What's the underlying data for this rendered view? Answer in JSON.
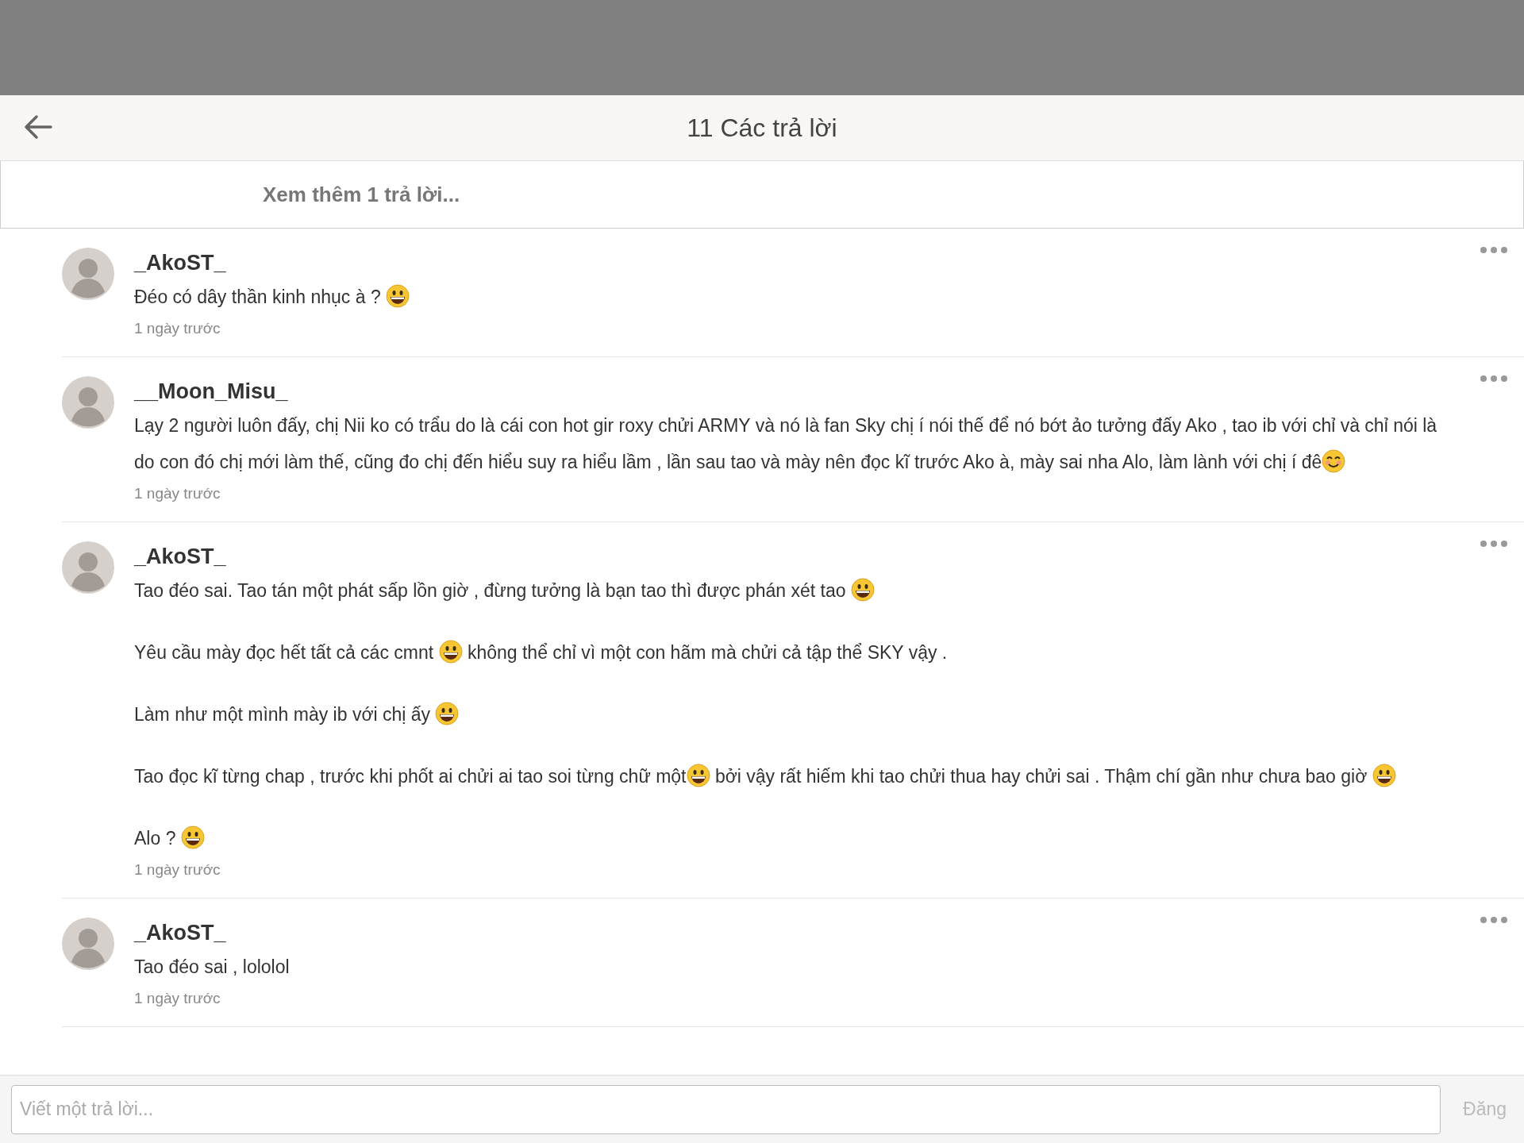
{
  "header": {
    "title": "11 Các trả lời"
  },
  "load_more": "Xem thêm 1 trả lời...",
  "comments": [
    {
      "author": "_AkoST_",
      "time": "1 ngày trước",
      "paragraphs": [
        [
          {
            "kind": "text",
            "text": "Đéo có dây thần kinh nhục à ? "
          },
          {
            "kind": "grin"
          }
        ]
      ]
    },
    {
      "author": "__Moon_Misu_",
      "time": "1 ngày trước",
      "paragraphs": [
        [
          {
            "kind": "text",
            "text": "Lạy 2 người luôn đấy, chị Nii ko có trẩu do là cái con hot gir roxy chửi ARMY và nó là fan Sky chị í nói thế để nó bớt ảo tưởng đấy Ako , tao ib với chỉ và chỉ nói là"
          }
        ],
        [
          {
            "kind": "text",
            "text": "do con đó chị mới làm thế, cũng đo chị đến hiểu suy ra hiểu lầm , lần sau tao và mày nên đọc kĩ trước Ako à, mày sai nha Alo, làm lành với chị í đê"
          },
          {
            "kind": "smile"
          }
        ]
      ]
    },
    {
      "author": "_AkoST_",
      "time": "1 ngày trước",
      "paragraphs": [
        [
          {
            "kind": "text",
            "text": "Tao đéo sai. Tao tán một phát sấp lồn giờ , đừng tưởng là bạn tao thì được phán xét tao "
          },
          {
            "kind": "grin"
          }
        ],
        [
          {
            "kind": "text",
            "text": "Yêu cầu mày đọc hết tất cả các cmnt "
          },
          {
            "kind": "grin"
          },
          {
            "kind": "text",
            "text": " không thể chỉ vì một con hãm mà chửi cả tập thể SKY vậy ."
          }
        ],
        [
          {
            "kind": "text",
            "text": "Làm như một mình mày ib với chị ấy "
          },
          {
            "kind": "grin"
          }
        ],
        [
          {
            "kind": "text",
            "text": "Tao đọc kĩ từng chap , trước khi phốt ai chửi ai tao soi từng chữ một"
          },
          {
            "kind": "grin"
          },
          {
            "kind": "text",
            "text": " bởi vậy rất hiếm khi tao chửi thua hay chửi sai . Thậm chí gần như chưa bao giờ "
          },
          {
            "kind": "grin"
          }
        ],
        [
          {
            "kind": "text",
            "text": "Alo ? "
          },
          {
            "kind": "grin"
          }
        ]
      ]
    },
    {
      "author": "_AkoST_",
      "time": "1 ngày trước",
      "paragraphs": [
        [
          {
            "kind": "text",
            "text": "Tao đéo sai , lololol"
          }
        ]
      ]
    }
  ],
  "reply_field": {
    "placeholder": "Viết một trả lời..."
  },
  "post_button": "Đăng"
}
